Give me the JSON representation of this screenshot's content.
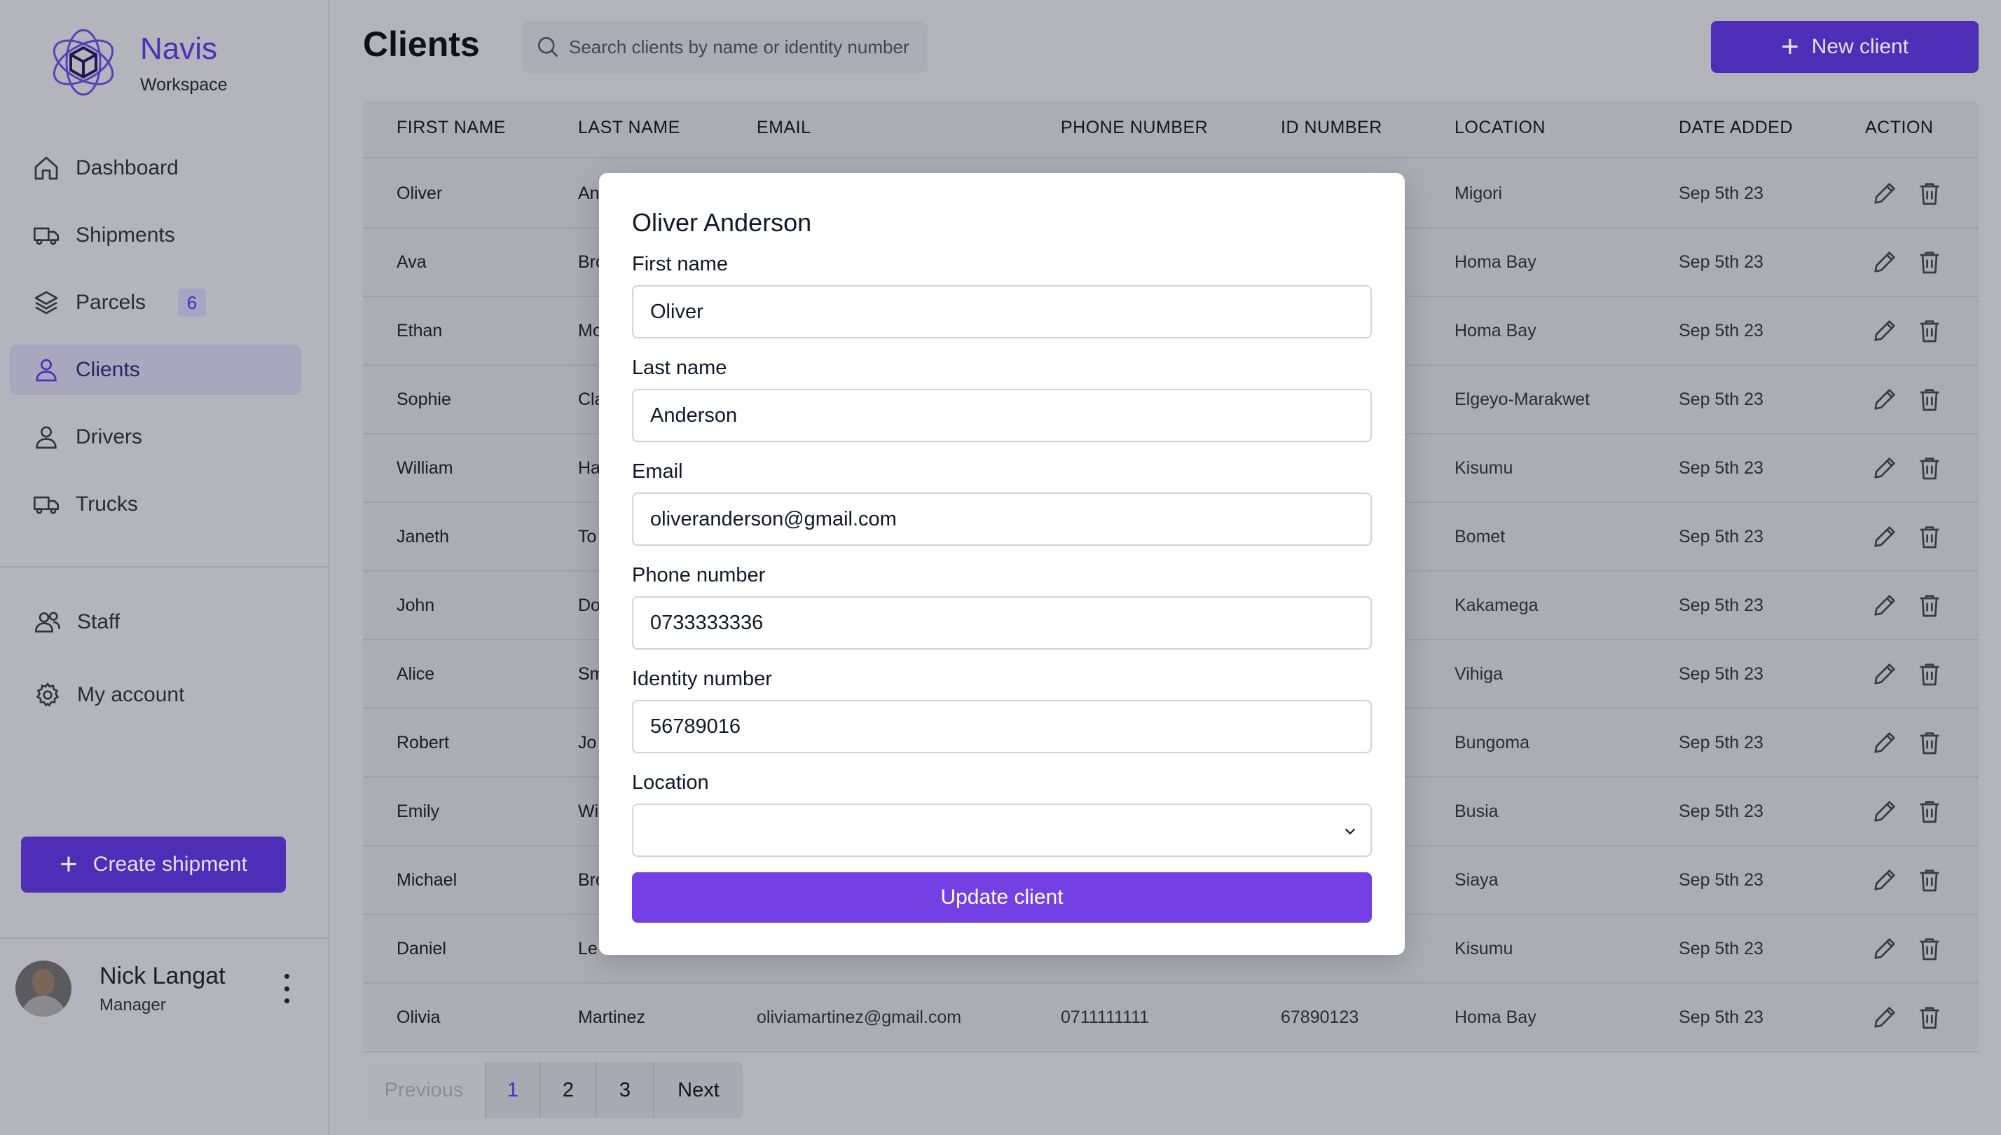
{
  "brand": {
    "name": "Navis",
    "subtitle": "Workspace"
  },
  "nav": [
    {
      "label": "Dashboard",
      "icon": "home-icon"
    },
    {
      "label": "Shipments",
      "icon": "truck-icon"
    },
    {
      "label": "Parcels",
      "icon": "layers-icon",
      "badge": "6"
    },
    {
      "label": "Clients",
      "icon": "user-icon",
      "active": true
    },
    {
      "label": "Drivers",
      "icon": "user-icon"
    },
    {
      "label": "Trucks",
      "icon": "truck-icon"
    }
  ],
  "nav_secondary": [
    {
      "label": "Staff",
      "icon": "users-icon"
    },
    {
      "label": "My account",
      "icon": "gear-icon"
    }
  ],
  "create_shipment_label": "Create shipment",
  "profile": {
    "name": "Nick Langat",
    "role": "Manager"
  },
  "page_title": "Clients",
  "search": {
    "placeholder": "Search clients by name or identity number"
  },
  "new_client_label": "New client",
  "table": {
    "columns": [
      "FIRST NAME",
      "LAST NAME",
      "EMAIL",
      "PHONE NUMBER",
      "ID NUMBER",
      "LOCATION",
      "DATE ADDED",
      "ACTION"
    ],
    "rows": [
      {
        "first": "Oliver",
        "last": "An",
        "email": "",
        "phone": "",
        "id": "",
        "location": "Migori",
        "date": "Sep 5th 23"
      },
      {
        "first": "Ava",
        "last": "Bro",
        "email": "",
        "phone": "",
        "id": "",
        "location": "Homa Bay",
        "date": "Sep 5th 23"
      },
      {
        "first": "Ethan",
        "last": "Mo",
        "email": "",
        "phone": "",
        "id": "",
        "location": "Homa Bay",
        "date": "Sep 5th 23"
      },
      {
        "first": "Sophie",
        "last": "Cla",
        "email": "",
        "phone": "",
        "id": "",
        "location": "Elgeyo-Marakwet",
        "date": "Sep 5th 23"
      },
      {
        "first": "William",
        "last": "Ha",
        "email": "",
        "phone": "",
        "id": "",
        "location": "Kisumu",
        "date": "Sep 5th 23"
      },
      {
        "first": "Janeth",
        "last": "To",
        "email": "",
        "phone": "",
        "id": "",
        "location": "Bomet",
        "date": "Sep 5th 23"
      },
      {
        "first": "John",
        "last": "Do",
        "email": "",
        "phone": "",
        "id": "",
        "location": "Kakamega",
        "date": "Sep 5th 23"
      },
      {
        "first": "Alice",
        "last": "Sm",
        "email": "",
        "phone": "",
        "id": "",
        "location": "Vihiga",
        "date": "Sep 5th 23"
      },
      {
        "first": "Robert",
        "last": "Jo",
        "email": "",
        "phone": "",
        "id": "",
        "location": "Bungoma",
        "date": "Sep 5th 23"
      },
      {
        "first": "Emily",
        "last": "Wi",
        "email": "",
        "phone": "",
        "id": "",
        "location": "Busia",
        "date": "Sep 5th 23"
      },
      {
        "first": "Michael",
        "last": "Bro",
        "email": "",
        "phone": "",
        "id": "",
        "location": "Siaya",
        "date": "Sep 5th 23"
      },
      {
        "first": "Daniel",
        "last": "Le",
        "email": "",
        "phone": "",
        "id": "",
        "location": "Kisumu",
        "date": "Sep 5th 23"
      },
      {
        "first": "Olivia",
        "last": "Martinez",
        "email": "oliviamartinez@gmail.com",
        "phone": "0711111111",
        "id": "67890123",
        "location": "Homa Bay",
        "date": "Sep 5th 23"
      }
    ]
  },
  "pagination": {
    "previous": "Previous",
    "pages": [
      "1",
      "2",
      "3"
    ],
    "next": "Next",
    "current": "1"
  },
  "modal": {
    "title": "Oliver Anderson",
    "first_name_label": "First name",
    "first_name_value": "Oliver",
    "last_name_label": "Last name",
    "last_name_value": "Anderson",
    "email_label": "Email",
    "email_value": "oliveranderson@gmail.com",
    "phone_label": "Phone number",
    "phone_value": "0733333336",
    "identity_label": "Identity number",
    "identity_value": "56789016",
    "location_label": "Location",
    "location_value": "",
    "submit_label": "Update client"
  },
  "colors": {
    "accent": "#4e2db7",
    "accent_bright": "#7440e3",
    "overlay_bg": "#b3b3bc"
  }
}
